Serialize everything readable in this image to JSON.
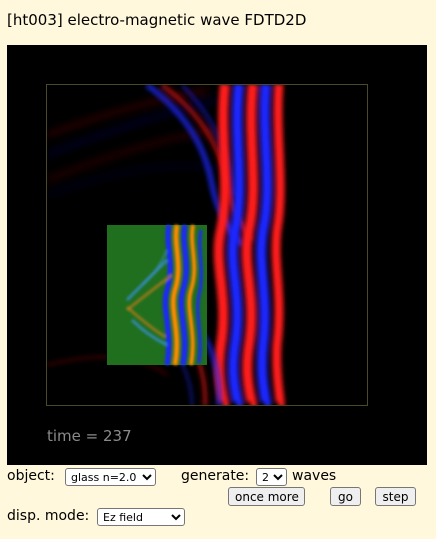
{
  "title": "[ht003] electro-magnetic wave FDTD2D",
  "canvas": {
    "time_text": "time = 237",
    "colors": {
      "background": "#000000",
      "frame": "#4a4a2a",
      "object": "#1f6f1f",
      "positive": "#ff1a1a",
      "negative": "#1a28ff"
    }
  },
  "controls": {
    "object_label": "object:",
    "object_value": "glass n=2.0",
    "generate_label": "generate:",
    "generate_value": "2",
    "waves_label": "waves",
    "once_more_label": "once more",
    "go_label": "go",
    "step_label": "step",
    "disp_label": "disp. mode:",
    "disp_value": "Ez field"
  }
}
